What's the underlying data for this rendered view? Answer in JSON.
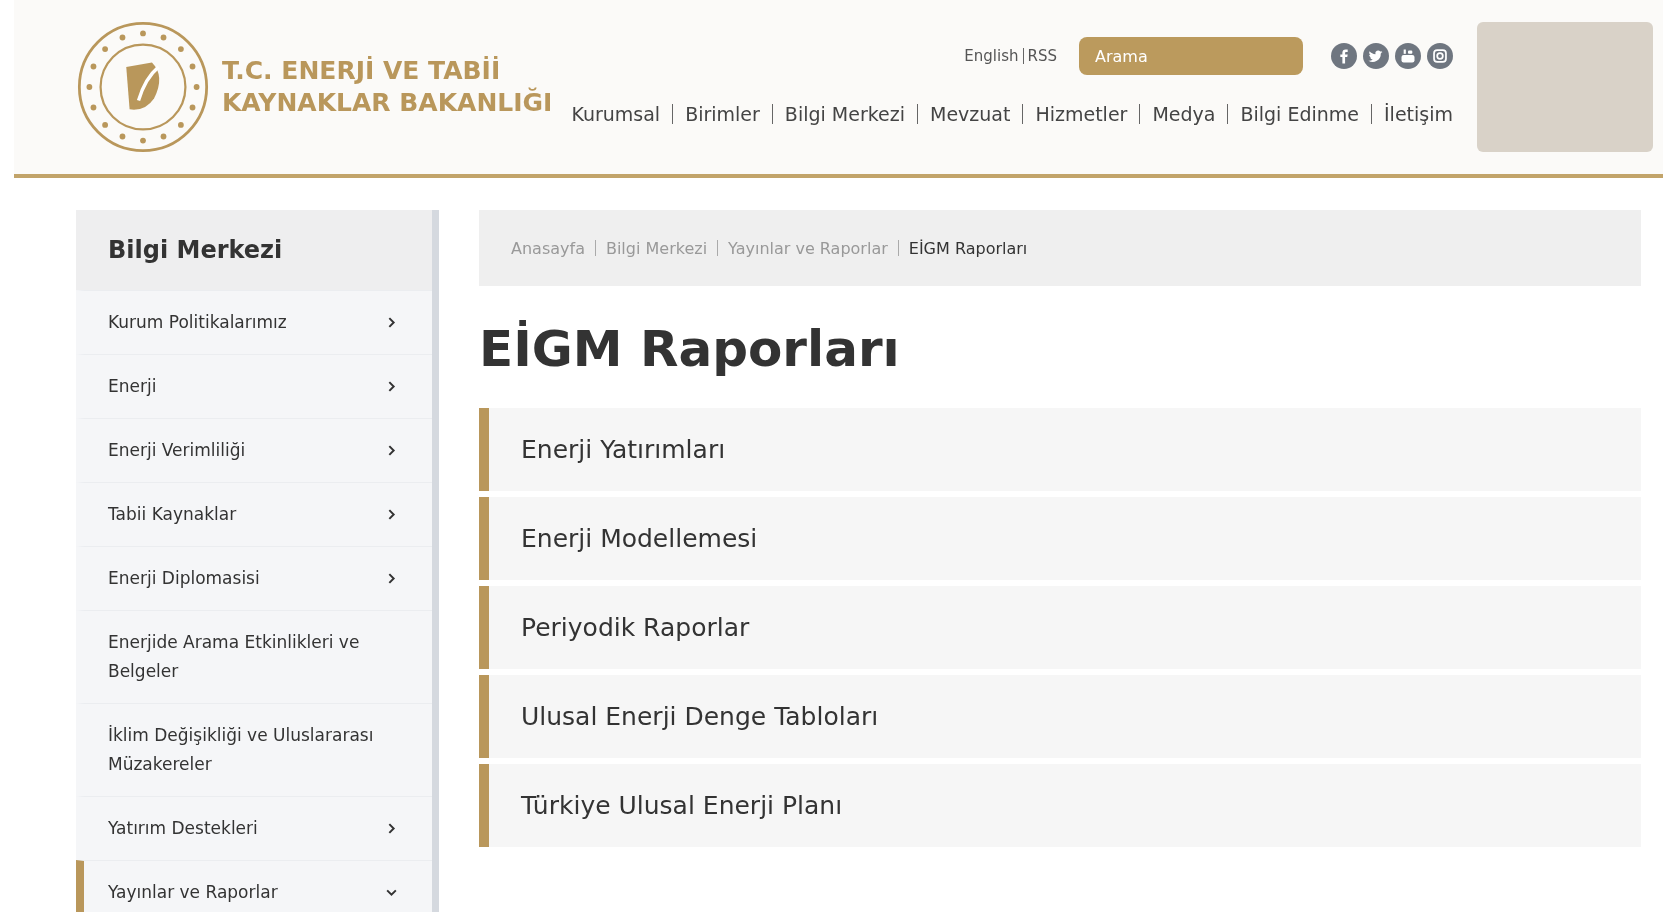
{
  "header": {
    "logo_text": [
      "T.C. ENERJİ VE TABİİ",
      "KAYNAKLAR BAKANLIĞI"
    ],
    "lang_links": [
      "English",
      "RSS"
    ],
    "search": {
      "placeholder": "Arama"
    },
    "social": [
      {
        "kind": "facebook"
      },
      {
        "kind": "twitter"
      },
      {
        "kind": "youtube"
      },
      {
        "kind": "instagram"
      }
    ],
    "nav": [
      "Kurumsal",
      "Birimler",
      "Bilgi Merkezi",
      "Mevzuat",
      "Hizmetler",
      "Medya",
      "Bilgi Edinme",
      "İletişim"
    ]
  },
  "sidebar": {
    "title": "Bilgi Merkezi",
    "items": [
      {
        "label": "Kurum Politikalarımız",
        "kind": "submenu",
        "expanded": false,
        "selected": false
      },
      {
        "label": "Enerji",
        "kind": "submenu",
        "expanded": false,
        "selected": false
      },
      {
        "label": "Enerji Verimliliği",
        "kind": "submenu",
        "expanded": false,
        "selected": false
      },
      {
        "label": "Tabii Kaynaklar",
        "kind": "submenu",
        "expanded": false,
        "selected": false
      },
      {
        "label": "Enerji Diplomasisi",
        "kind": "submenu",
        "expanded": false,
        "selected": false
      },
      {
        "label": "Enerjide Arama Etkinlikleri ve Belgeler",
        "kind": "link",
        "selected": false
      },
      {
        "label": "İklim Değişikliği ve Uluslararası Müzakereler",
        "kind": "link",
        "selected": false
      },
      {
        "label": "Yatırım Destekleri",
        "kind": "submenu",
        "expanded": false,
        "selected": false
      },
      {
        "label": "Yayınlar ve Raporlar",
        "kind": "submenu",
        "expanded": true,
        "selected": true
      }
    ]
  },
  "breadcrumb": [
    "Anasayfa",
    "Bilgi Merkezi",
    "Yayınlar ve Raporlar",
    "EİGM Raporları"
  ],
  "page_title": "EİGM Raporları",
  "reports": [
    "Enerji Yatırımları",
    "Enerji Modellemesi",
    "Periyodik Raporlar",
    "Ulusal Enerji Denge Tabloları",
    "Türkiye Ulusal Enerji Planı"
  ]
}
